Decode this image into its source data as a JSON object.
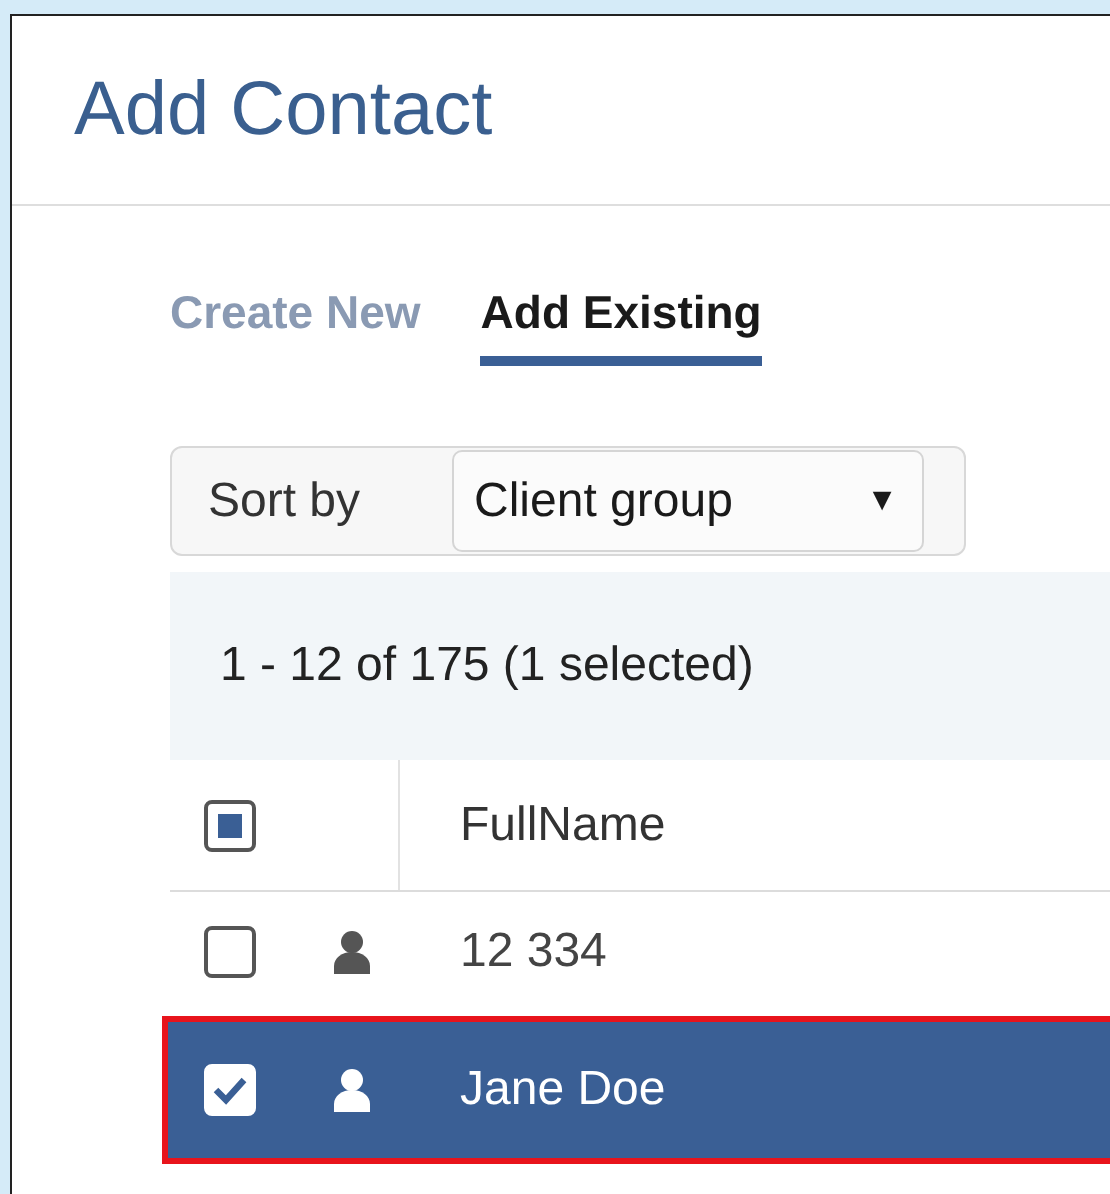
{
  "dialog": {
    "title": "Add Contact"
  },
  "tabs": [
    {
      "label": "Create New",
      "selected": false
    },
    {
      "label": "Add Existing",
      "selected": true
    }
  ],
  "sort": {
    "label": "Sort by",
    "value": "Client group",
    "caret": "▼"
  },
  "summary": "1 - 12 of 175 (1 selected)",
  "table": {
    "select_all_indeterminate": true,
    "columns": [
      "FullName"
    ],
    "rows": [
      {
        "name": "12 334",
        "selected": false,
        "annotated": false
      },
      {
        "name": "Jane Doe",
        "selected": true,
        "annotated": true
      }
    ]
  }
}
